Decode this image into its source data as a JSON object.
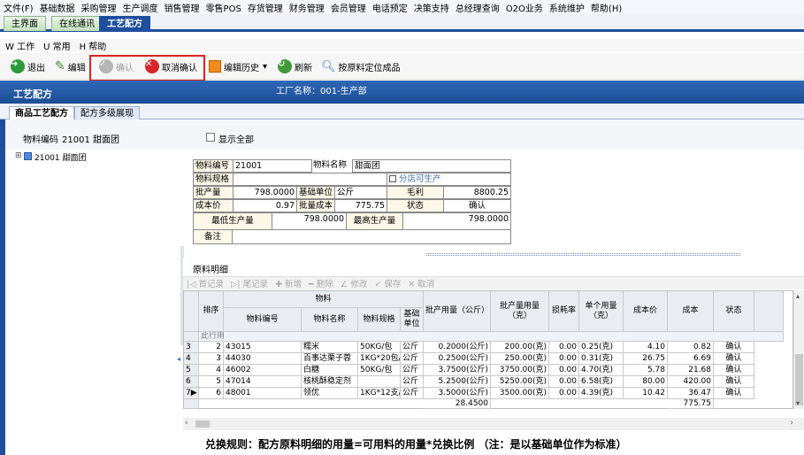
{
  "menu": [
    "文件(F)",
    "基础数据",
    "采购管理",
    "生产调度",
    "销售管理",
    "零售POS",
    "存货管理",
    "财务管理",
    "会员管理",
    "电话预定",
    "决策支持",
    "总经理查询",
    "O2O业务",
    "系统维护",
    "帮助(H)"
  ],
  "tabs": [
    "主界面",
    "在线通讯",
    "工艺配方"
  ],
  "submenu": [
    "W 工作",
    "U 常用",
    "H 帮助"
  ],
  "toolbar": {
    "exit": "退出",
    "edit": "编辑",
    "confirm": "确认",
    "cancel_confirm": "取消确认",
    "edit_history": "编辑历史",
    "refresh": "刷新",
    "locate": "按原料定位成品"
  },
  "title": {
    "left": "工艺配方",
    "factory": "工厂名称：001-生产部"
  },
  "subtabs": [
    "商品工艺配方",
    "配方多级展现"
  ],
  "filter": {
    "label": "物料编码",
    "value": "21001  甜面团",
    "show_all": "显示全部"
  },
  "tree": {
    "toggle": "⊞",
    "item": "21001 甜面团"
  },
  "form": {
    "code_label": "物料编号",
    "code": "21001",
    "name_label": "物料名称",
    "name": "甜面团",
    "spec_label": "物料规格",
    "spec": "",
    "branch_label": "分店可生产",
    "batch_label": "批产量",
    "batch": "798.0000",
    "unit_label": "基础单位",
    "unit": "公斤",
    "gross_label": "毛利",
    "gross": "8800.25",
    "cost_label": "成本价",
    "cost": "0.97",
    "batch_cost_label": "批量成本",
    "batch_cost": "775.75",
    "status_label": "状态",
    "status": "确认",
    "min_label": "最低生产量",
    "min": "798.0000",
    "max_label": "最高生产量",
    "max": "798.0000",
    "note_label": "备注",
    "note": ""
  },
  "detail": {
    "title": "原料明细",
    "nav": [
      "|◁ 首记录",
      "▷| 尾记录",
      "✚ 新增",
      "━ 删除",
      "∠ 修改",
      "✓ 保存",
      "✕ 取消"
    ]
  },
  "grid": {
    "group_header": "物料",
    "columns": [
      "排序",
      "物料编号",
      "物料名称",
      "物料规格",
      "基础单位",
      "批产用量（公斤）",
      "批产量用量（克）",
      "损耗率",
      "单个用量（克）",
      "成本价",
      "成本",
      "状态"
    ],
    "filter_row": "此行用",
    "rows": [
      {
        "idx": "3",
        "sort": "2",
        "code": "43015",
        "name": "糯米",
        "spec": "50KG/包",
        "unit": "公斤",
        "kg": "0.2000(公斤)",
        "g": "200.00(克)",
        "loss": "0.00",
        "single": "0.25(克)",
        "price": "4.10",
        "cost": "0.82",
        "status": "确认"
      },
      {
        "idx": "4",
        "sort": "3",
        "code": "44030",
        "name": "百事达栗子蓉",
        "spec": "1KG*20包/",
        "unit": "公斤",
        "kg": "0.2500(公斤)",
        "g": "250.00(克)",
        "loss": "0.00",
        "single": "0.31(克)",
        "price": "26.75",
        "cost": "6.69",
        "status": "确认"
      },
      {
        "idx": "5",
        "sort": "4",
        "code": "46002",
        "name": "白糖",
        "spec": "50KG/包",
        "unit": "公斤",
        "kg": "3.7500(公斤)",
        "g": "3750.00(克)",
        "loss": "0.00",
        "single": "4.70(克)",
        "price": "5.78",
        "cost": "21.68",
        "status": "确认"
      },
      {
        "idx": "6",
        "sort": "5",
        "code": "47014",
        "name": "核桃酥稳定剂",
        "spec": "",
        "unit": "公斤",
        "kg": "5.2500(公斤)",
        "g": "5250.00(克)",
        "loss": "0.00",
        "single": "6.58(克)",
        "price": "80.00",
        "cost": "420.00",
        "status": "确认"
      },
      {
        "idx": "7▶",
        "sort": "6",
        "code": "48001",
        "name": "领优",
        "spec": "1KG*12支/",
        "unit": "公斤",
        "kg": "3.5000(公斤)",
        "g": "3500.00(克)",
        "loss": "0.00",
        "single": "4.39(克)",
        "price": "10.42",
        "cost": "36.47",
        "status": "确认"
      }
    ],
    "total_kg": "28.4500",
    "total_cost": "775.75"
  },
  "footer": "兑换规则：配方原料明细的用量=可用料的用量*兑换比例  （注：是以基础单位作为标准）"
}
